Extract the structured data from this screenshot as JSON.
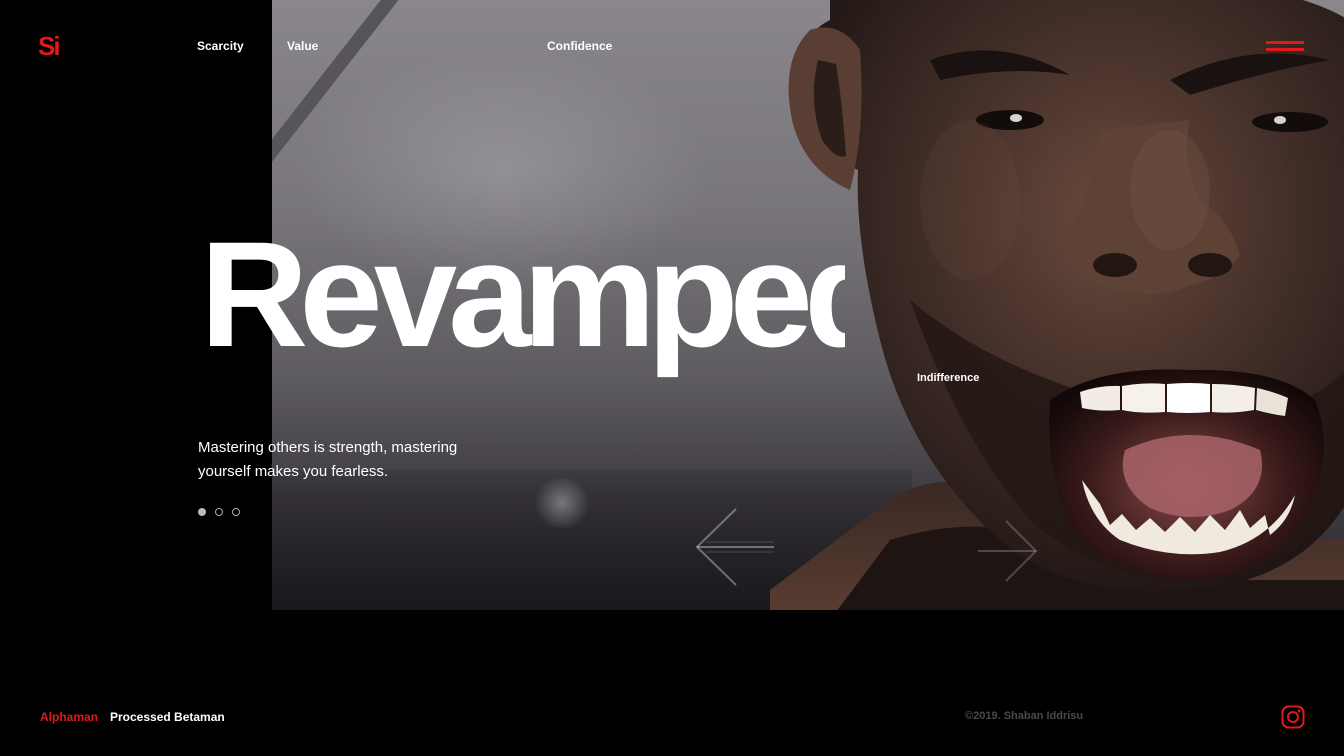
{
  "brand": {
    "logo_text": "Si",
    "accent_color": "#e01a1a"
  },
  "nav": {
    "items": [
      {
        "label": "Scarcity"
      },
      {
        "label": "Value"
      },
      {
        "label": "Confidence"
      }
    ],
    "menu_icon": "hamburger-icon"
  },
  "hero": {
    "headline": "Revamped",
    "side_label": "Indifference",
    "tagline": "Mastering others is strength, mastering yourself makes you fearless.",
    "slides": {
      "count": 3,
      "active_index": 0
    },
    "prev_icon": "arrow-left-icon",
    "next_icon": "arrow-right-icon"
  },
  "footer": {
    "links": [
      {
        "label": "Alphaman",
        "active": true
      },
      {
        "label": "Processed Betaman",
        "active": false
      }
    ],
    "copyright": "©2019. Shaban Iddrisu",
    "social_icon": "instagram-icon"
  }
}
